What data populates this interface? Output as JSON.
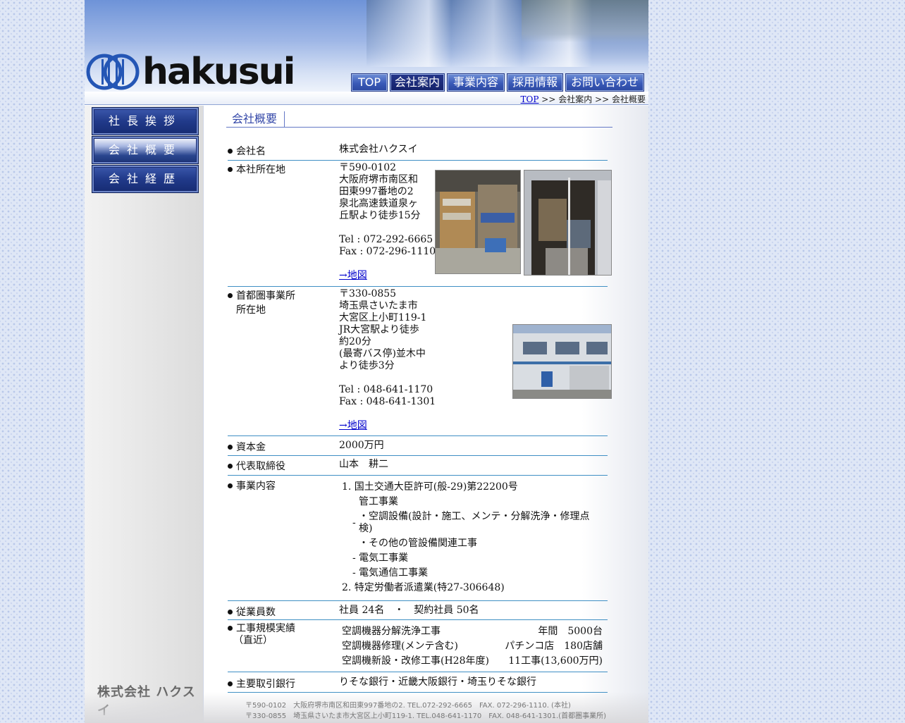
{
  "brand": {
    "logo_text": "hakusui",
    "company_mark": "株式会社 ハクスイ"
  },
  "global_nav": [
    {
      "label": "TOP",
      "active": false
    },
    {
      "label": "会社案内",
      "active": true
    },
    {
      "label": "事業内容",
      "active": false
    },
    {
      "label": "採用情報",
      "active": false
    },
    {
      "label": "お問い合わせ",
      "active": false
    }
  ],
  "breadcrumb": {
    "home": "TOP",
    "sep1": " >> ",
    "level1": "会社案内",
    "sep2": " >> ",
    "current": "会社概要"
  },
  "sidebar": [
    {
      "label": "社長挨拶",
      "active": false
    },
    {
      "label": "会社概要",
      "active": true
    },
    {
      "label": "会社経歴",
      "active": false
    }
  ],
  "section_title": "会社概要",
  "profile": {
    "company_name": {
      "label": "会社名",
      "value": "株式会社ハクスイ"
    },
    "head_office": {
      "label": "本社所在地",
      "lines": [
        "〒590-0102",
        "大阪府堺市南区和",
        "田東997番地の2",
        "泉北高速鉄道泉ヶ",
        "丘駅より徒歩15分",
        "",
        "Tel : 072-292-6665",
        "Fax : 072-296-1110",
        ""
      ],
      "map_link": "→地図"
    },
    "tokyo_office": {
      "label_line1": "首都圏事業所",
      "label_line2": "所在地",
      "lines": [
        "〒330-0855",
        "埼玉県さいたま市",
        "大宮区上小町119-1",
        "JR大宮駅より徒歩",
        "約20分",
        "(最寄バス停)並木中",
        "より徒歩3分",
        "",
        "Tel : 048-641-1170",
        "Fax : 048-641-1301",
        ""
      ],
      "map_link": "→地図"
    },
    "capital": {
      "label": "資本金",
      "value": "2000万円"
    },
    "representative": {
      "label": "代表取締役",
      "value": "山本　耕二"
    },
    "business": {
      "label": "事業内容",
      "item1": "1. 国土交通大臣許可(般-29)第22200号",
      "item1_sub_title": "管工事業",
      "item1_sub_a_line1": "・空調設備(設計・施工、メンテ・分解洗浄・修理点",
      "item1_sub_a_line2": "検)",
      "item1_sub_b": "・その他の管設備関連工事",
      "item1_elec": "- 電気工事業",
      "item1_comm": "- 電気通信工事業",
      "item1_dash": "-",
      "item2": "2. 特定労働者派遣業(特27-306648)"
    },
    "employees": {
      "label": "従業員数",
      "value": "社員 24名　・　契約社員 50名"
    },
    "results": {
      "label_line1": "工事規模実績",
      "label_line2": "（直近）",
      "rows": [
        {
          "left": "空調機器分解洗浄工事",
          "right": "年間　5000台"
        },
        {
          "left": "空調機器修理(メンテ含む)",
          "right": "パチンコ店　180店舗"
        },
        {
          "left": "空調機新設・改修工事(H28年度)",
          "right": "11工事(13,600万円)"
        }
      ]
    },
    "banks": {
      "label": "主要取引銀行",
      "value": "りそな銀行・近畿大阪銀行・埼玉りそな銀行"
    }
  },
  "footer": {
    "line1": "〒590-0102　大阪府堺市南区和田東997番地の2. TEL.072-292-6665　FAX. 072-296-1110. (本社)",
    "line2": "〒330-0855　埼玉県さいたま市大宮区上小町119-1. TEL.048-641-1170　FAX. 048-641-1301.(首都圏事業所)"
  }
}
